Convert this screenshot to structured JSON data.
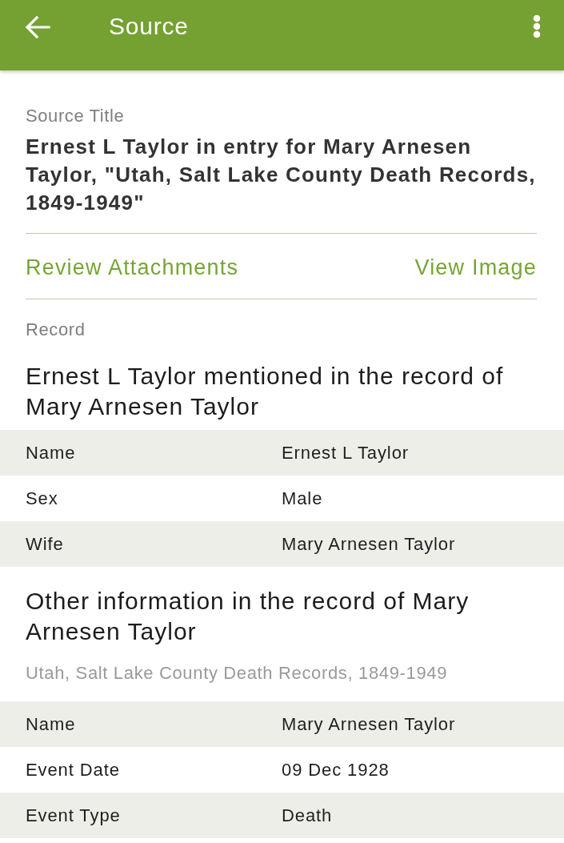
{
  "app_bar": {
    "title": "Source"
  },
  "source": {
    "label": "Source Title",
    "title": "Ernest L Taylor in entry for Mary Arnesen Taylor, \"Utah, Salt Lake County Death Records, 1849-1949\""
  },
  "actions": [
    {
      "label": "Review Attachments"
    },
    {
      "label": "View Image"
    }
  ],
  "record": {
    "label": "Record",
    "heading": "Ernest L Taylor mentioned in the record of Mary Arnesen Taylor",
    "fields": [
      {
        "label": "Name",
        "value": "Ernest L Taylor"
      },
      {
        "label": "Sex",
        "value": "Male"
      },
      {
        "label": "Wife",
        "value": "Mary Arnesen Taylor"
      }
    ]
  },
  "other_information": {
    "heading": "Other information in the record of Mary Arnesen Taylor",
    "collection": "Utah, Salt Lake County Death Records, 1849-1949",
    "fields": [
      {
        "label": "Name",
        "value": "Mary Arnesen Taylor"
      },
      {
        "label": "Event Date",
        "value": "09 Dec 1928"
      },
      {
        "label": "Event Type",
        "value": "Death"
      }
    ]
  }
}
